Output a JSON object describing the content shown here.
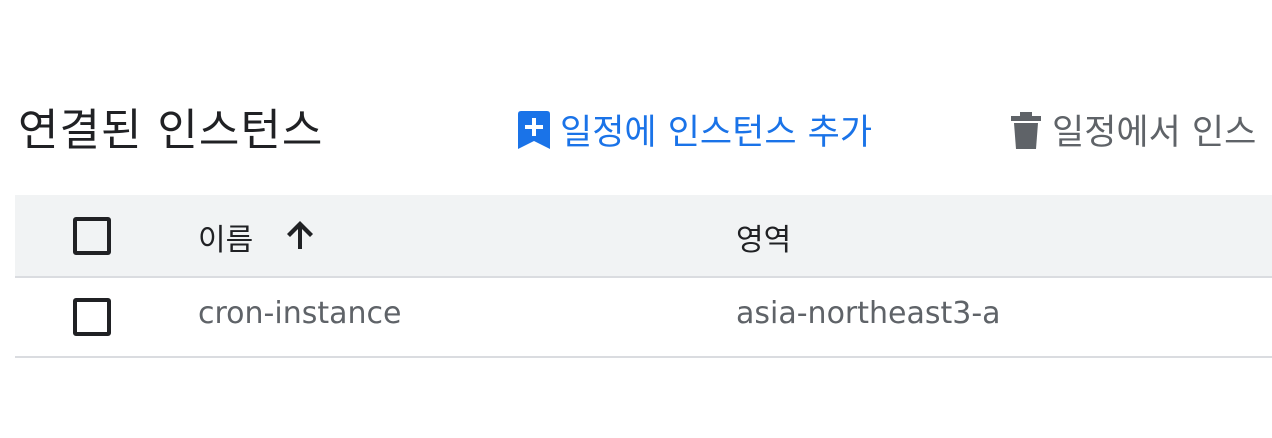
{
  "header": {
    "title": "연결된 인스턴스"
  },
  "actions": {
    "add": {
      "label": "일정에 인스턴스 추가",
      "icon": "add-bookmark-icon",
      "color": "#1a73e8"
    },
    "remove": {
      "label": "일정에서 인스",
      "icon": "trash-icon",
      "color": "#5f6368"
    }
  },
  "table": {
    "columns": [
      {
        "label": "이름",
        "sort": "ascending",
        "sort_icon": "arrow-up-icon"
      },
      {
        "label": "영역"
      }
    ],
    "rows": [
      {
        "name": "cron-instance",
        "zone": "asia-northeast3-a",
        "selected": false
      }
    ],
    "header_background": "#f1f3f4"
  }
}
